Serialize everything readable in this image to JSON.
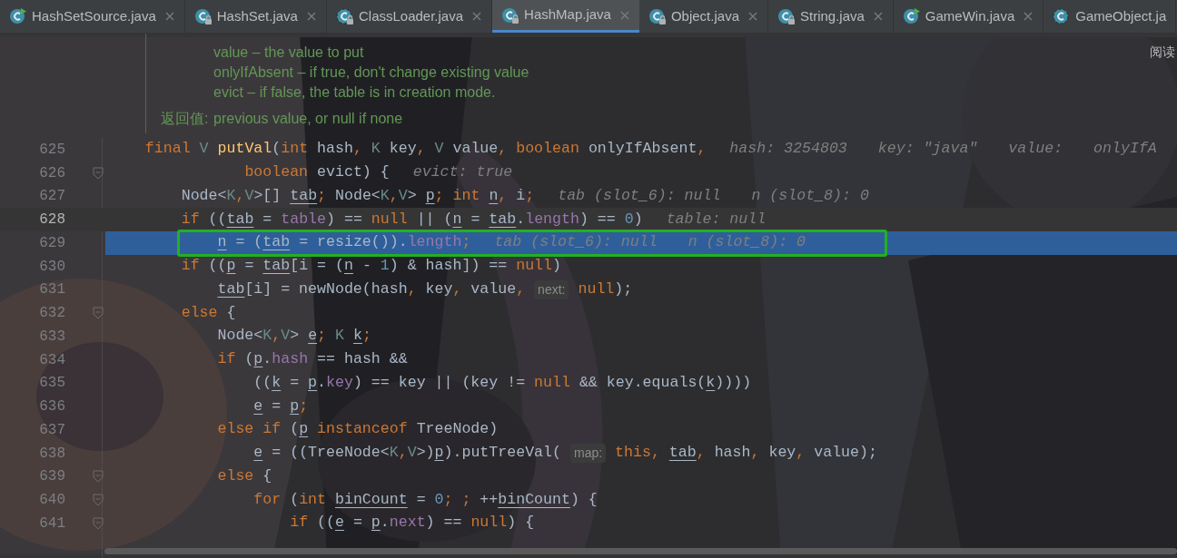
{
  "tabs": [
    {
      "label": "HashSetSource.java",
      "kind": "run",
      "selected": false,
      "close": true
    },
    {
      "label": "HashSet.java",
      "kind": "locked",
      "selected": false,
      "close": true
    },
    {
      "label": "ClassLoader.java",
      "kind": "abstract-locked",
      "selected": false,
      "close": true
    },
    {
      "label": "HashMap.java",
      "kind": "locked",
      "selected": true,
      "close": true
    },
    {
      "label": "Object.java",
      "kind": "locked",
      "selected": false,
      "close": true
    },
    {
      "label": "String.java",
      "kind": "locked",
      "selected": false,
      "close": true
    },
    {
      "label": "GameWin.java",
      "kind": "run",
      "selected": false,
      "close": true
    },
    {
      "label": "GameObject.ja",
      "kind": "abstract",
      "selected": false,
      "close": false
    }
  ],
  "reader_mode": "阅读",
  "doc": {
    "params": [
      "value – the value to put",
      "onlyIfAbsent – if true, don't change existing value",
      "evict – if false, the table is in creation mode."
    ],
    "return_label": "返回值:",
    "return_text": "previous value, or null if none"
  },
  "lines": [
    {
      "number": "625",
      "current": false,
      "selected": false,
      "outlined": false,
      "fold": false,
      "segments": [
        {
          "kind": "code",
          "tokens": [
            {
              "text": "    final ",
              "kind": "keyword"
            },
            {
              "text": "V ",
              "kind": "type"
            },
            {
              "text": "putVal",
              "kind": "method"
            },
            {
              "text": "(",
              "kind": "plain"
            },
            {
              "text": "int ",
              "kind": "keyword"
            },
            {
              "text": "hash",
              "kind": "plain"
            },
            {
              "text": ", ",
              "kind": "keyword"
            },
            {
              "text": "K ",
              "kind": "type"
            },
            {
              "text": "key",
              "kind": "plain"
            },
            {
              "text": ", ",
              "kind": "keyword"
            },
            {
              "text": "V ",
              "kind": "type"
            },
            {
              "text": "value",
              "kind": "plain"
            },
            {
              "text": ", ",
              "kind": "keyword"
            },
            {
              "text": "boolean ",
              "kind": "keyword"
            },
            {
              "text": "onlyIfAbsent",
              "kind": "plain"
            },
            {
              "text": ",",
              "kind": "keyword"
            }
          ]
        },
        {
          "kind": "hint",
          "text": "hash: 3254803"
        },
        {
          "kind": "hint",
          "text": "key: \"java\""
        },
        {
          "kind": "hint",
          "text": "value:"
        },
        {
          "kind": "hint",
          "text": "onlyIfA"
        }
      ]
    },
    {
      "number": "626",
      "current": false,
      "selected": false,
      "outlined": false,
      "fold": true,
      "segments": [
        {
          "kind": "code",
          "tokens": [
            {
              "text": "               boolean ",
              "kind": "keyword"
            },
            {
              "text": "evict) {",
              "kind": "plain"
            }
          ]
        },
        {
          "kind": "hint",
          "text": "evict: true"
        }
      ]
    },
    {
      "number": "627",
      "current": false,
      "selected": false,
      "outlined": false,
      "fold": false,
      "segments": [
        {
          "kind": "code",
          "tokens": [
            {
              "text": "        Node<",
              "kind": "plain"
            },
            {
              "text": "K",
              "kind": "type"
            },
            {
              "text": ",",
              "kind": "keyword"
            },
            {
              "text": "V",
              "kind": "type"
            },
            {
              "text": ">[] ",
              "kind": "plain"
            },
            {
              "text": "tab",
              "kind": "var"
            },
            {
              "text": "; ",
              "kind": "keyword"
            },
            {
              "text": "Node<",
              "kind": "plain"
            },
            {
              "text": "K",
              "kind": "type"
            },
            {
              "text": ",",
              "kind": "keyword"
            },
            {
              "text": "V",
              "kind": "type"
            },
            {
              "text": "> ",
              "kind": "plain"
            },
            {
              "text": "p",
              "kind": "var"
            },
            {
              "text": "; ",
              "kind": "keyword"
            },
            {
              "text": "int ",
              "kind": "keyword"
            },
            {
              "text": "n",
              "kind": "var"
            },
            {
              "text": ", ",
              "kind": "keyword"
            },
            {
              "text": "i",
              "kind": "plain"
            },
            {
              "text": ";",
              "kind": "keyword"
            }
          ]
        },
        {
          "kind": "hint",
          "text": "tab (slot_6): null"
        },
        {
          "kind": "hint",
          "text": "n (slot_8): 0"
        }
      ]
    },
    {
      "number": "628",
      "current": true,
      "selected": false,
      "outlined": false,
      "fold": false,
      "segments": [
        {
          "kind": "code",
          "tokens": [
            {
              "text": "        if ",
              "kind": "keyword"
            },
            {
              "text": "((",
              "kind": "plain"
            },
            {
              "text": "tab",
              "kind": "var"
            },
            {
              "text": " = ",
              "kind": "plain"
            },
            {
              "text": "table",
              "kind": "field"
            },
            {
              "text": ") == ",
              "kind": "plain"
            },
            {
              "text": "null ",
              "kind": "keyword"
            },
            {
              "text": "|| (",
              "kind": "plain"
            },
            {
              "text": "n",
              "kind": "var"
            },
            {
              "text": " = ",
              "kind": "plain"
            },
            {
              "text": "tab",
              "kind": "var"
            },
            {
              "text": ".",
              "kind": "plain"
            },
            {
              "text": "length",
              "kind": "field"
            },
            {
              "text": ") == ",
              "kind": "plain"
            },
            {
              "text": "0",
              "kind": "number"
            },
            {
              "text": ")",
              "kind": "plain"
            }
          ]
        },
        {
          "kind": "hint",
          "text": "table: null"
        }
      ]
    },
    {
      "number": "629",
      "current": false,
      "selected": true,
      "outlined": true,
      "fold": false,
      "segments": [
        {
          "kind": "code",
          "tokens": [
            {
              "text": "            n",
              "kind": "var"
            },
            {
              "text": " = (",
              "kind": "plain"
            },
            {
              "text": "tab",
              "kind": "var"
            },
            {
              "text": " = resize()).",
              "kind": "plain"
            },
            {
              "text": "length",
              "kind": "field"
            },
            {
              "text": ";",
              "kind": "keyword"
            }
          ]
        },
        {
          "kind": "hint",
          "text": "tab (slot_6): null"
        },
        {
          "kind": "hint",
          "text": "n (slot_8): 0"
        }
      ]
    },
    {
      "number": "630",
      "current": false,
      "selected": false,
      "outlined": false,
      "fold": false,
      "segments": [
        {
          "kind": "code",
          "tokens": [
            {
              "text": "        if ",
              "kind": "keyword"
            },
            {
              "text": "((",
              "kind": "plain"
            },
            {
              "text": "p",
              "kind": "var"
            },
            {
              "text": " = ",
              "kind": "plain"
            },
            {
              "text": "tab",
              "kind": "var"
            },
            {
              "text": "[i = (",
              "kind": "plain"
            },
            {
              "text": "n",
              "kind": "var"
            },
            {
              "text": " - ",
              "kind": "plain"
            },
            {
              "text": "1",
              "kind": "number"
            },
            {
              "text": ") & hash]) == ",
              "kind": "plain"
            },
            {
              "text": "null",
              "kind": "keyword"
            },
            {
              "text": ")",
              "kind": "plain"
            }
          ]
        }
      ]
    },
    {
      "number": "631",
      "current": false,
      "selected": false,
      "outlined": false,
      "fold": false,
      "segments": [
        {
          "kind": "code",
          "tokens": [
            {
              "text": "            tab",
              "kind": "var"
            },
            {
              "text": "[i] = newNode(hash",
              "kind": "plain"
            },
            {
              "text": ", ",
              "kind": "keyword"
            },
            {
              "text": "key",
              "kind": "plain"
            },
            {
              "text": ", ",
              "kind": "keyword"
            },
            {
              "text": "value",
              "kind": "plain"
            },
            {
              "text": ",",
              "kind": "keyword"
            }
          ]
        },
        {
          "kind": "inlay",
          "text": "next:"
        },
        {
          "kind": "code",
          "tokens": [
            {
              "text": "null",
              "kind": "keyword"
            },
            {
              "text": ");",
              "kind": "plain"
            }
          ]
        }
      ]
    },
    {
      "number": "632",
      "current": false,
      "selected": false,
      "outlined": false,
      "fold": true,
      "segments": [
        {
          "kind": "code",
          "tokens": [
            {
              "text": "        else ",
              "kind": "keyword"
            },
            {
              "text": "{",
              "kind": "plain"
            }
          ]
        }
      ]
    },
    {
      "number": "633",
      "current": false,
      "selected": false,
      "outlined": false,
      "fold": false,
      "segments": [
        {
          "kind": "code",
          "tokens": [
            {
              "text": "            Node<",
              "kind": "plain"
            },
            {
              "text": "K",
              "kind": "type"
            },
            {
              "text": ",",
              "kind": "keyword"
            },
            {
              "text": "V",
              "kind": "type"
            },
            {
              "text": "> ",
              "kind": "plain"
            },
            {
              "text": "e",
              "kind": "var"
            },
            {
              "text": "; ",
              "kind": "keyword"
            },
            {
              "text": "K ",
              "kind": "type"
            },
            {
              "text": "k",
              "kind": "var"
            },
            {
              "text": ";",
              "kind": "keyword"
            }
          ]
        }
      ]
    },
    {
      "number": "634",
      "current": false,
      "selected": false,
      "outlined": false,
      "fold": false,
      "segments": [
        {
          "kind": "code",
          "tokens": [
            {
              "text": "            if ",
              "kind": "keyword"
            },
            {
              "text": "(",
              "kind": "plain"
            },
            {
              "text": "p",
              "kind": "var"
            },
            {
              "text": ".",
              "kind": "plain"
            },
            {
              "text": "hash",
              "kind": "field"
            },
            {
              "text": " == hash &&",
              "kind": "plain"
            }
          ]
        }
      ]
    },
    {
      "number": "635",
      "current": false,
      "selected": false,
      "outlined": false,
      "fold": false,
      "segments": [
        {
          "kind": "code",
          "tokens": [
            {
              "text": "                ((",
              "kind": "plain"
            },
            {
              "text": "k",
              "kind": "var"
            },
            {
              "text": " = ",
              "kind": "plain"
            },
            {
              "text": "p",
              "kind": "var"
            },
            {
              "text": ".",
              "kind": "plain"
            },
            {
              "text": "key",
              "kind": "field"
            },
            {
              "text": ") == key || (key != ",
              "kind": "plain"
            },
            {
              "text": "null ",
              "kind": "keyword"
            },
            {
              "text": "&& key.equals(",
              "kind": "plain"
            },
            {
              "text": "k",
              "kind": "var"
            },
            {
              "text": "))))",
              "kind": "plain"
            }
          ]
        }
      ]
    },
    {
      "number": "636",
      "current": false,
      "selected": false,
      "outlined": false,
      "fold": false,
      "segments": [
        {
          "kind": "code",
          "tokens": [
            {
              "text": "                e",
              "kind": "var"
            },
            {
              "text": " = ",
              "kind": "plain"
            },
            {
              "text": "p",
              "kind": "var"
            },
            {
              "text": ";",
              "kind": "keyword"
            }
          ]
        }
      ]
    },
    {
      "number": "637",
      "current": false,
      "selected": false,
      "outlined": false,
      "fold": false,
      "segments": [
        {
          "kind": "code",
          "tokens": [
            {
              "text": "            else if ",
              "kind": "keyword"
            },
            {
              "text": "(",
              "kind": "plain"
            },
            {
              "text": "p",
              "kind": "var"
            },
            {
              "text": " instanceof ",
              "kind": "keyword"
            },
            {
              "text": "TreeNode)",
              "kind": "plain"
            }
          ]
        }
      ]
    },
    {
      "number": "638",
      "current": false,
      "selected": false,
      "outlined": false,
      "fold": false,
      "segments": [
        {
          "kind": "code",
          "tokens": [
            {
              "text": "                e",
              "kind": "var"
            },
            {
              "text": " = ((TreeNode<",
              "kind": "plain"
            },
            {
              "text": "K",
              "kind": "type"
            },
            {
              "text": ",",
              "kind": "keyword"
            },
            {
              "text": "V",
              "kind": "type"
            },
            {
              "text": ">)",
              "kind": "plain"
            },
            {
              "text": "p",
              "kind": "var"
            },
            {
              "text": ").putTreeVal(",
              "kind": "plain"
            }
          ]
        },
        {
          "kind": "inlay",
          "text": "map:"
        },
        {
          "kind": "code",
          "tokens": [
            {
              "text": "this",
              "kind": "keyword"
            },
            {
              "text": ", ",
              "kind": "keyword"
            },
            {
              "text": "tab",
              "kind": "var"
            },
            {
              "text": ", ",
              "kind": "keyword"
            },
            {
              "text": "hash",
              "kind": "plain"
            },
            {
              "text": ", ",
              "kind": "keyword"
            },
            {
              "text": "key",
              "kind": "plain"
            },
            {
              "text": ", ",
              "kind": "keyword"
            },
            {
              "text": "value",
              "kind": "plain"
            },
            {
              "text": ");",
              "kind": "plain"
            }
          ]
        }
      ]
    },
    {
      "number": "639",
      "current": false,
      "selected": false,
      "outlined": false,
      "fold": true,
      "segments": [
        {
          "kind": "code",
          "tokens": [
            {
              "text": "            else ",
              "kind": "keyword"
            },
            {
              "text": "{",
              "kind": "plain"
            }
          ]
        }
      ]
    },
    {
      "number": "640",
      "current": false,
      "selected": false,
      "outlined": false,
      "fold": true,
      "segments": [
        {
          "kind": "code",
          "tokens": [
            {
              "text": "                for ",
              "kind": "keyword"
            },
            {
              "text": "(",
              "kind": "plain"
            },
            {
              "text": "int ",
              "kind": "keyword"
            },
            {
              "text": "binCount",
              "kind": "var"
            },
            {
              "text": " = ",
              "kind": "plain"
            },
            {
              "text": "0",
              "kind": "number"
            },
            {
              "text": "; ; ",
              "kind": "keyword"
            },
            {
              "text": "++",
              "kind": "plain"
            },
            {
              "text": "binCount",
              "kind": "var"
            },
            {
              "text": ") {",
              "kind": "plain"
            }
          ]
        }
      ]
    },
    {
      "number": "641",
      "current": false,
      "selected": false,
      "outlined": false,
      "fold": true,
      "segments": [
        {
          "kind": "code",
          "tokens": [
            {
              "text": "                    if ",
              "kind": "keyword"
            },
            {
              "text": "((",
              "kind": "plain"
            },
            {
              "text": "e",
              "kind": "var"
            },
            {
              "text": " = ",
              "kind": "plain"
            },
            {
              "text": "p",
              "kind": "var"
            },
            {
              "text": ".",
              "kind": "plain"
            },
            {
              "text": "next",
              "kind": "field"
            },
            {
              "text": ") == ",
              "kind": "plain"
            },
            {
              "text": "null",
              "kind": "keyword"
            },
            {
              "text": ") {",
              "kind": "plain"
            }
          ]
        }
      ]
    }
  ]
}
